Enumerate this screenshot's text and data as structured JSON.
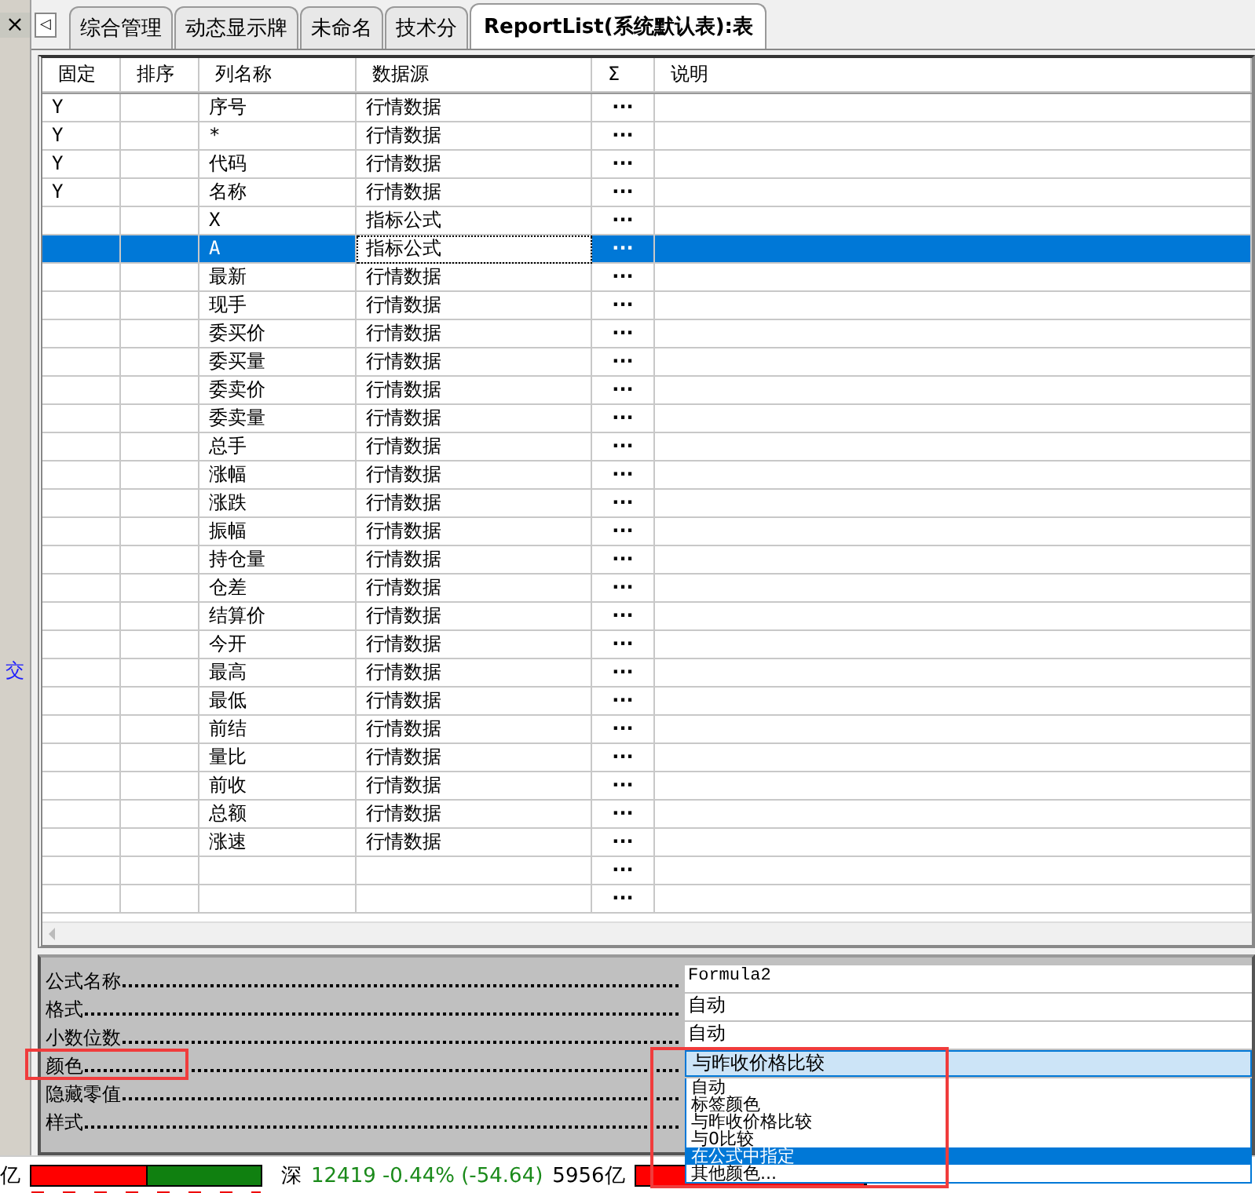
{
  "left_strip": {
    "close_glyph": "×",
    "side_label": "交"
  },
  "tabs": {
    "scroll_glyph": "◁",
    "items": [
      {
        "label": "综合管理",
        "selected": false
      },
      {
        "label": "动态显示牌",
        "selected": false
      },
      {
        "label": "未命名",
        "selected": false
      },
      {
        "label": "技术分",
        "selected": false
      },
      {
        "label": "ReportList(系统默认表):表",
        "selected": true
      }
    ]
  },
  "table": {
    "columns": [
      "固定",
      "排序",
      "列名称",
      "数据源",
      "Σ",
      "说明"
    ],
    "rows": [
      {
        "fixed": "Y",
        "name": "序号",
        "source": "行情数据",
        "sum": "···",
        "selected": false
      },
      {
        "fixed": "Y",
        "name": "*",
        "source": "行情数据",
        "sum": "···",
        "selected": false
      },
      {
        "fixed": "Y",
        "name": "代码",
        "source": "行情数据",
        "sum": "···",
        "selected": false
      },
      {
        "fixed": "Y",
        "name": "名称",
        "source": "行情数据",
        "sum": "···",
        "selected": false
      },
      {
        "name": "X",
        "source": "指标公式",
        "sum": "···",
        "selected": false
      },
      {
        "name": "A",
        "source": "指标公式",
        "sum": "···",
        "selected": true
      },
      {
        "name": "最新",
        "source": "行情数据",
        "sum": "···",
        "selected": false
      },
      {
        "name": "现手",
        "source": "行情数据",
        "sum": "···",
        "selected": false
      },
      {
        "name": "委买价",
        "source": "行情数据",
        "sum": "···",
        "selected": false
      },
      {
        "name": "委买量",
        "source": "行情数据",
        "sum": "···",
        "selected": false
      },
      {
        "name": "委卖价",
        "source": "行情数据",
        "sum": "···",
        "selected": false
      },
      {
        "name": "委卖量",
        "source": "行情数据",
        "sum": "···",
        "selected": false
      },
      {
        "name": "总手",
        "source": "行情数据",
        "sum": "···",
        "selected": false
      },
      {
        "name": "涨幅",
        "source": "行情数据",
        "sum": "···",
        "selected": false
      },
      {
        "name": "涨跌",
        "source": "行情数据",
        "sum": "···",
        "selected": false
      },
      {
        "name": "振幅",
        "source": "行情数据",
        "sum": "···",
        "selected": false
      },
      {
        "name": "持仓量",
        "source": "行情数据",
        "sum": "···",
        "selected": false
      },
      {
        "name": "仓差",
        "source": "行情数据",
        "sum": "···",
        "selected": false
      },
      {
        "name": "结算价",
        "source": "行情数据",
        "sum": "···",
        "selected": false
      },
      {
        "name": "今开",
        "source": "行情数据",
        "sum": "···",
        "selected": false
      },
      {
        "name": "最高",
        "source": "行情数据",
        "sum": "···",
        "selected": false
      },
      {
        "name": "最低",
        "source": "行情数据",
        "sum": "···",
        "selected": false
      },
      {
        "name": "前结",
        "source": "行情数据",
        "sum": "···",
        "selected": false
      },
      {
        "name": "量比",
        "source": "行情数据",
        "sum": "···",
        "selected": false
      },
      {
        "name": "前收",
        "source": "行情数据",
        "sum": "···",
        "selected": false
      },
      {
        "name": "总额",
        "source": "行情数据",
        "sum": "···",
        "selected": false
      },
      {
        "name": "涨速",
        "source": "行情数据",
        "sum": "···",
        "selected": false
      },
      {
        "sum": "···",
        "selected": false
      },
      {
        "sum": "···",
        "selected": false
      }
    ]
  },
  "properties": [
    {
      "label": "公式名称",
      "kind": "text",
      "value": "Formula2"
    },
    {
      "label": "格式",
      "kind": "text",
      "value": "自动"
    },
    {
      "label": "小数位数",
      "kind": "text",
      "value": "自动"
    },
    {
      "label": "颜色",
      "kind": "combo",
      "value": "与昨收价格比较",
      "highlighted": true
    },
    {
      "label": "隐藏零值",
      "kind": "empty"
    },
    {
      "label": "样式",
      "kind": "empty"
    }
  ],
  "dropdown": {
    "options": [
      {
        "label": "自动",
        "selected": false
      },
      {
        "label": "标签颜色",
        "selected": false
      },
      {
        "label": "与昨收价格比较",
        "selected": false
      },
      {
        "label": "与0比较",
        "selected": false
      },
      {
        "label": "在公式中指定",
        "selected": true
      },
      {
        "label": "其他颜色...",
        "selected": false
      }
    ]
  },
  "status_bar": {
    "lead": "亿",
    "bars": [
      {
        "level": 0.5
      },
      {
        "level": 1
      }
    ],
    "market": "深",
    "quote": "12419 -0.44% (-54.64)",
    "volume": "5956亿"
  }
}
